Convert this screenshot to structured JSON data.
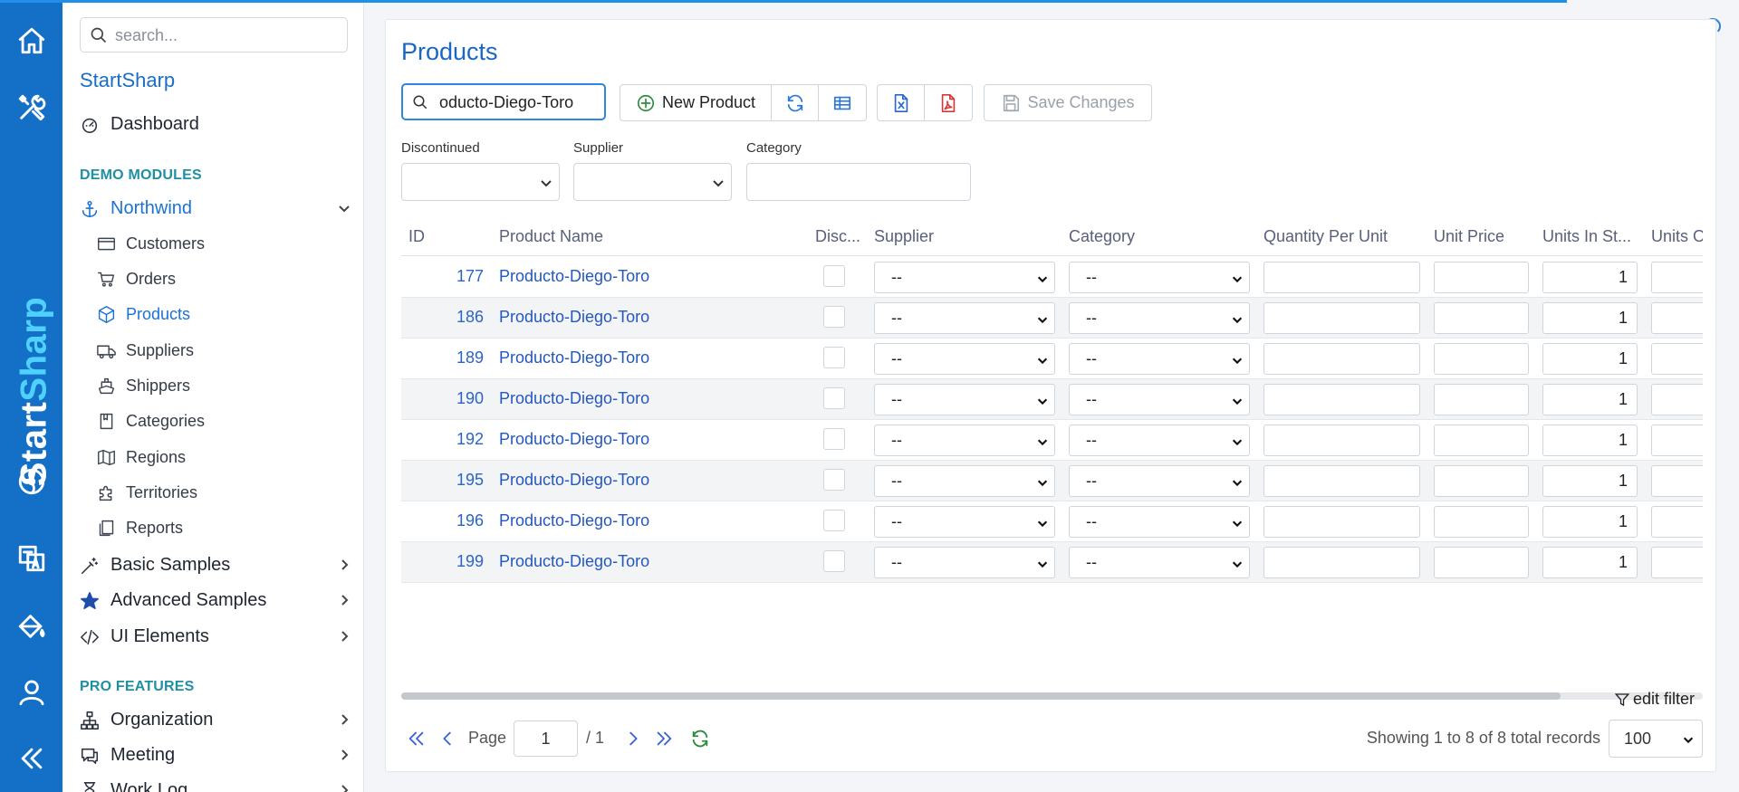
{
  "sidebar": {
    "search_placeholder": "search...",
    "app_title": "StartSharp",
    "dashboard": "Dashboard",
    "demo_header": "DEMO MODULES",
    "northwind": "Northwind",
    "northwind_items": [
      "Customers",
      "Orders",
      "Products",
      "Suppliers",
      "Shippers",
      "Categories",
      "Regions",
      "Territories",
      "Reports"
    ],
    "basic_samples": "Basic Samples",
    "advanced_samples": "Advanced Samples",
    "ui_elements": "UI Elements",
    "pro_header": "PRO FEATURES",
    "organization": "Organization",
    "meeting": "Meeting",
    "work_log": "Work Log"
  },
  "rail": {
    "brand_word_start": "Start",
    "brand_word_end": "Sharp"
  },
  "main": {
    "title": "Products",
    "quick_search_value": "oducto-Diego-Toro",
    "new_product": "New Product",
    "save_changes": "Save Changes",
    "filters": {
      "discontinued": "Discontinued",
      "supplier": "Supplier",
      "category": "Category"
    },
    "columns": [
      "ID",
      "Product Name",
      "Disc...",
      "Supplier",
      "Category",
      "Quantity Per Unit",
      "Unit Price",
      "Units In St...",
      "Units O"
    ],
    "rows": [
      {
        "id": "177",
        "name": "Producto-Diego-Toro",
        "supplier": "--",
        "category": "--",
        "units": "1"
      },
      {
        "id": "186",
        "name": "Producto-Diego-Toro",
        "supplier": "--",
        "category": "--",
        "units": "1"
      },
      {
        "id": "189",
        "name": "Producto-Diego-Toro",
        "supplier": "--",
        "category": "--",
        "units": "1"
      },
      {
        "id": "190",
        "name": "Producto-Diego-Toro",
        "supplier": "--",
        "category": "--",
        "units": "1"
      },
      {
        "id": "192",
        "name": "Producto-Diego-Toro",
        "supplier": "--",
        "category": "--",
        "units": "1"
      },
      {
        "id": "195",
        "name": "Producto-Diego-Toro",
        "supplier": "--",
        "category": "--",
        "units": "1"
      },
      {
        "id": "196",
        "name": "Producto-Diego-Toro",
        "supplier": "--",
        "category": "--",
        "units": "1"
      },
      {
        "id": "199",
        "name": "Producto-Diego-Toro",
        "supplier": "--",
        "category": "--",
        "units": "1"
      }
    ],
    "edit_filter": "edit filter",
    "pager": {
      "page_label": "Page",
      "page_value": "1",
      "page_total": "/ 1",
      "records": "Showing 1 to 8 of 8 total records",
      "page_size": "100"
    }
  }
}
